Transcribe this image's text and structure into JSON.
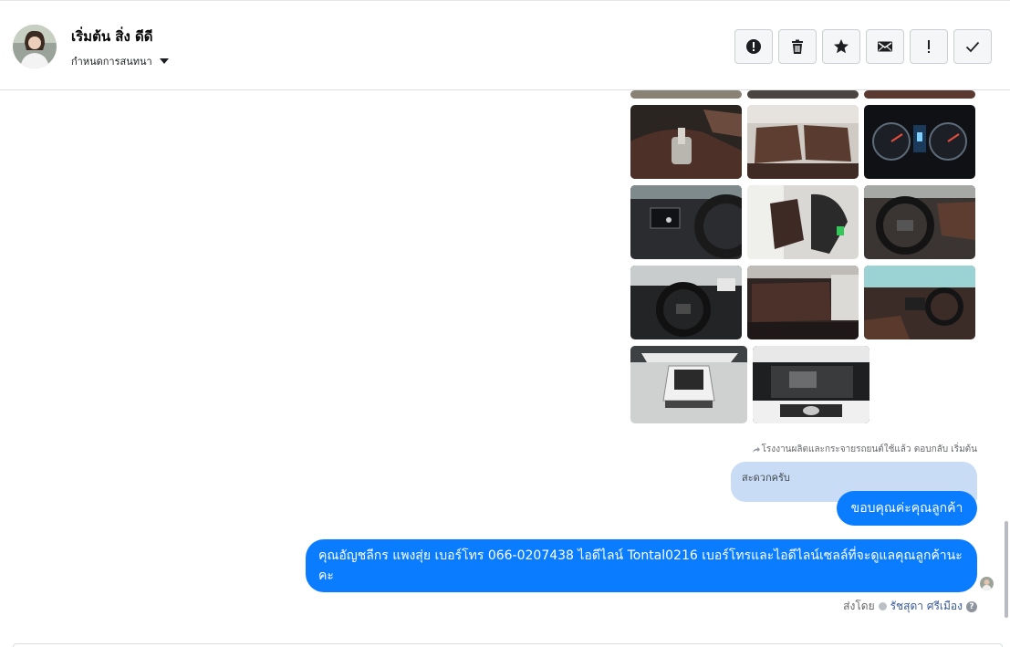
{
  "header": {
    "contact_name": "เริ่มต้น สิ่ง ดีดี",
    "assign_label": "กำหนดการสนทนา",
    "actions": [
      {
        "name": "report-icon",
        "label": "report"
      },
      {
        "name": "trash-icon",
        "label": "delete"
      },
      {
        "name": "star-icon",
        "label": "star"
      },
      {
        "name": "envelope-icon",
        "label": "unread"
      },
      {
        "name": "exclamation-icon",
        "label": "important"
      },
      {
        "name": "checkmark-icon",
        "label": "done"
      }
    ]
  },
  "thread": {
    "photos": [
      {
        "name": "car-photo-gear-console",
        "kind": "console"
      },
      {
        "name": "car-photo-rear-seats",
        "kind": "seats"
      },
      {
        "name": "car-photo-dashboard-gauges",
        "kind": "gauges"
      },
      {
        "name": "car-photo-steering-left",
        "kind": "steering"
      },
      {
        "name": "car-photo-front-seat",
        "kind": "seats"
      },
      {
        "name": "car-photo-steering-wheel",
        "kind": "steering"
      },
      {
        "name": "car-photo-driver-view",
        "kind": "steering"
      },
      {
        "name": "car-photo-rear-row",
        "kind": "seats"
      },
      {
        "name": "car-photo-front-cabin",
        "kind": "steering"
      },
      {
        "name": "car-photo-tailgate-open",
        "kind": "exterior"
      },
      {
        "name": "car-photo-engine-bay",
        "kind": "engine"
      }
    ],
    "reply_context": "โรงงานผลิตและกระจายรถยนต์ใช้แล้ว ตอบกลับ เริ่มต้น",
    "quoted_text": "สะดวกครับ",
    "reply_message": "ขอบคุณค่ะคุณลูกค้า",
    "info_message": "คุณอัญชลีกร แพงสุ่ย     เบอร์โทร 066-0207438 ไอดีไลน์ Tontal0216   เบอร์โทรและไอดีไลน์เซลล์ที่จะดูแลคุณลูกค้านะคะ",
    "sent_by_label": "ส่งโดย",
    "sent_by_name": "รัชสุดา ศรีเมือง",
    "help_glyph": "?"
  },
  "colors": {
    "bubble": "#0a7cff",
    "quoted_bg": "#c8dcf5"
  }
}
